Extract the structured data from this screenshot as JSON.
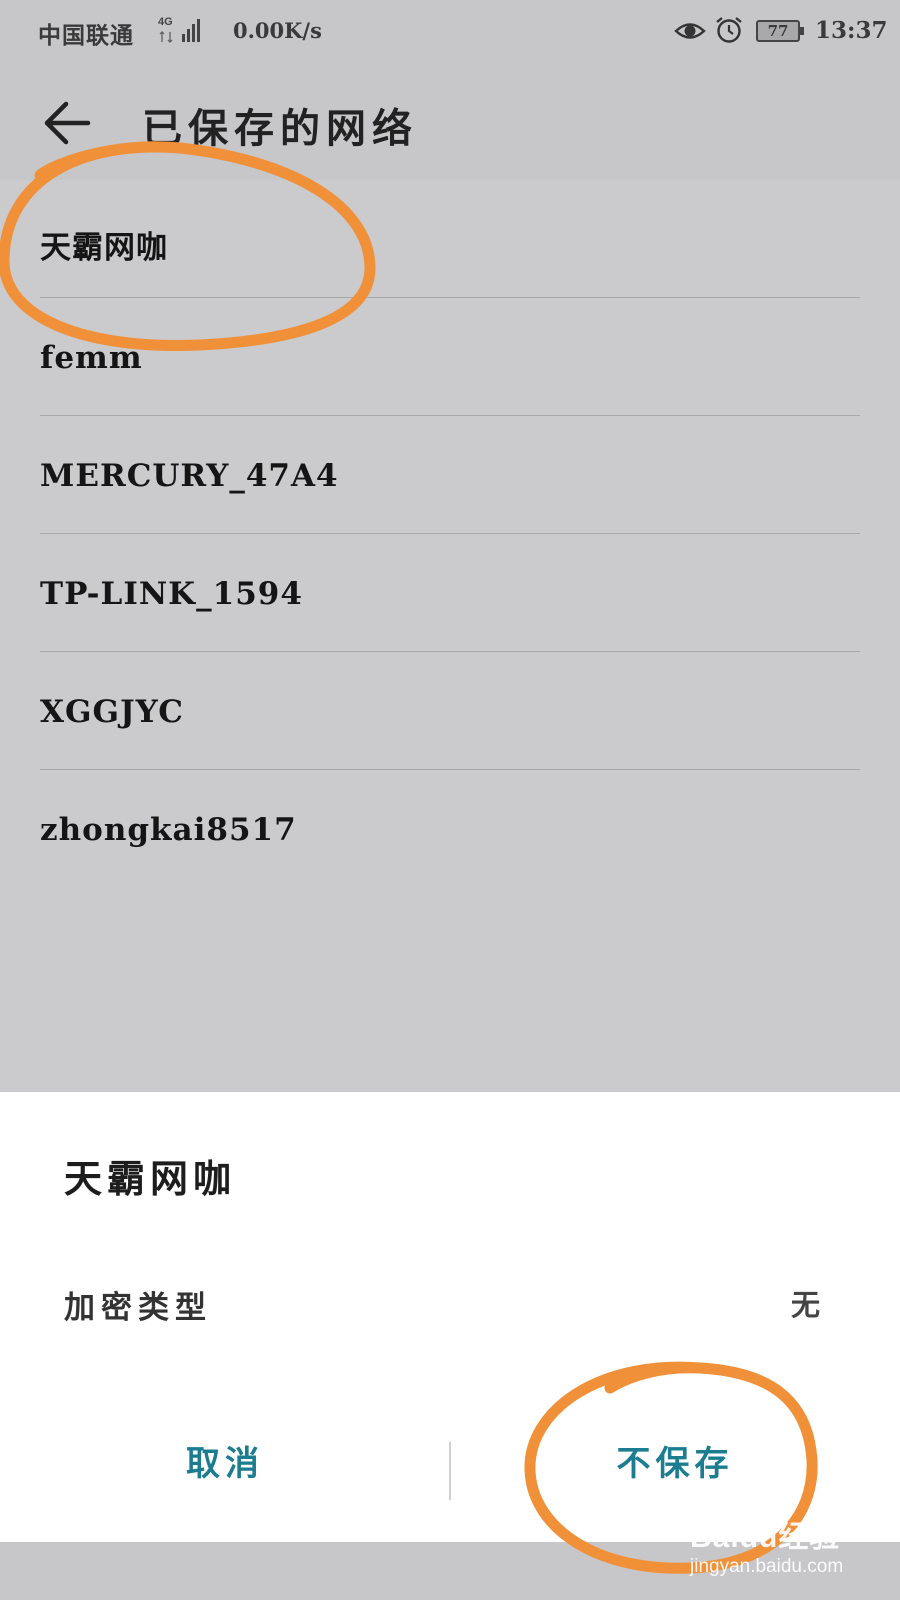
{
  "status_bar": {
    "carrier": "中国联通",
    "network_type": "4G",
    "speed": "0.00K/s",
    "battery": "77",
    "time": "13:37",
    "icons": [
      "signal-icon",
      "eye-icon",
      "alarm-icon",
      "battery-icon"
    ]
  },
  "header": {
    "title": "已保存的网络",
    "back_icon": "back-arrow-icon"
  },
  "networks": [
    {
      "name": "天霸网咖"
    },
    {
      "name": "femm"
    },
    {
      "name": "MERCURY_47A4"
    },
    {
      "name": "TP-LINK_1594"
    },
    {
      "name": "XGGJYC"
    },
    {
      "name": "zhongkai8517"
    }
  ],
  "dialog": {
    "title": "天霸网咖",
    "encryption_label": "加密类型",
    "encryption_value": "无",
    "cancel_label": "取消",
    "forget_label": "不保存"
  },
  "watermark": {
    "logo": "Baidu经验",
    "url": "jingyan.baidu.com"
  },
  "colors": {
    "background": "#cbcacd",
    "dialog_bg": "#ffffff",
    "button_text": "#1c7d90",
    "annotation": "#f0913a"
  }
}
